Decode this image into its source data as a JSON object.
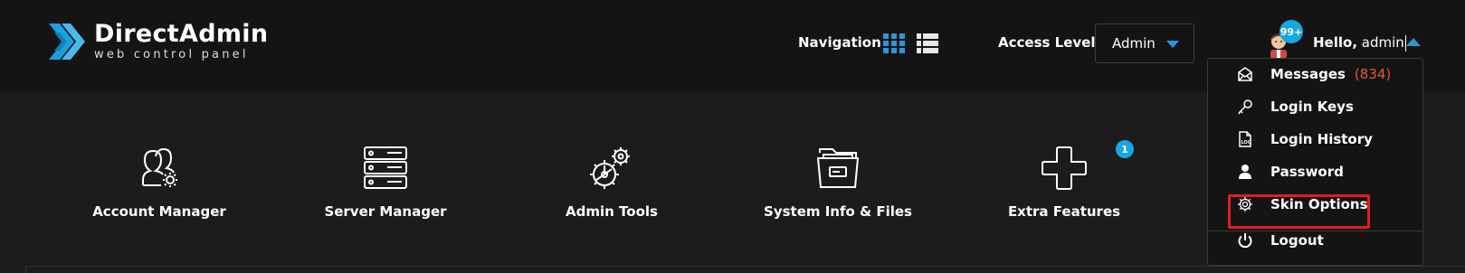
{
  "brand": {
    "title": "DirectAdmin",
    "subtitle": "web control panel"
  },
  "header": {
    "navigation_label": "Navigation",
    "access_level_label": "Access Level",
    "access_level_value": "Admin",
    "avatar_badge": "99+",
    "greeting_bold": "Hello,",
    "greeting_user": "admin"
  },
  "tiles": [
    {
      "label": "Account Manager",
      "icon": "account-manager-icon"
    },
    {
      "label": "Server Manager",
      "icon": "server-manager-icon"
    },
    {
      "label": "Admin Tools",
      "icon": "admin-tools-icon"
    },
    {
      "label": "System Info & Files",
      "icon": "system-info-files-icon"
    },
    {
      "label": "Extra Features",
      "icon": "extra-features-icon",
      "badge": "1"
    }
  ],
  "user_menu": {
    "items": [
      {
        "label": "Messages",
        "count": "(834)",
        "icon": "envelope-icon"
      },
      {
        "label": "Login Keys",
        "icon": "key-icon"
      },
      {
        "label": "Login History",
        "icon": "log-file-icon"
      },
      {
        "label": "Password",
        "icon": "user-icon"
      },
      {
        "label": "Skin Options",
        "icon": "gear-icon"
      },
      {
        "label": "Logout",
        "icon": "power-icon"
      }
    ],
    "highlighted_item": "Skin Options"
  },
  "colors": {
    "accent": "#2a98d8",
    "badge": "#17a7e0",
    "count": "#e05a3a",
    "highlight": "#e21d1d",
    "topbar": "#141414",
    "background": "#1c1c1c"
  }
}
